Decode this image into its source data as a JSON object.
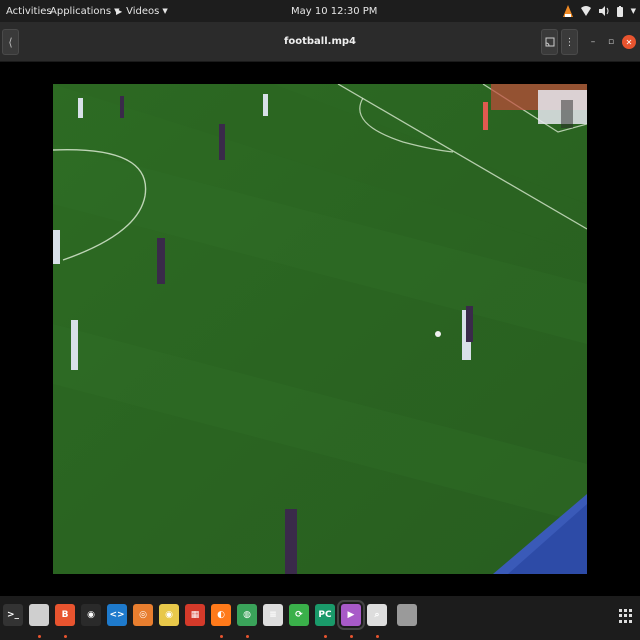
{
  "topbar": {
    "activities": "Activities",
    "applications": "Applications",
    "app_menu": "Videos",
    "clock": "May 10  12:30 PM"
  },
  "window": {
    "title": "football.mp4"
  },
  "dock": {
    "apps": [
      {
        "name": "terminal-icon",
        "glyph": ">_",
        "color": "#333333",
        "running": false
      },
      {
        "name": "files-icon",
        "glyph": "",
        "color": "#cfcfcf",
        "running": true
      },
      {
        "name": "brave-icon",
        "glyph": "B",
        "color": "#e8542f",
        "running": true
      },
      {
        "name": "obs-icon",
        "glyph": "◉",
        "color": "#2a2a2a",
        "running": false
      },
      {
        "name": "vscode-icon",
        "glyph": "<>",
        "color": "#1e7acc",
        "running": false
      },
      {
        "name": "ubuntu-software-icon",
        "glyph": "◎",
        "color": "#e87e2f",
        "running": false
      },
      {
        "name": "rhythmbox-icon",
        "glyph": "◉",
        "color": "#e8c84a",
        "running": false
      },
      {
        "name": "color-picker-icon",
        "glyph": "▦",
        "color": "#d43a2a",
        "running": false
      },
      {
        "name": "firefox-icon",
        "glyph": "◐",
        "color": "#ff7a1a",
        "running": true
      },
      {
        "name": "chrome-icon",
        "glyph": "◍",
        "color": "#3aa35a",
        "running": true
      },
      {
        "name": "text-editor-icon",
        "glyph": "≡",
        "color": "#dddddd",
        "running": false
      },
      {
        "name": "sync-icon",
        "glyph": "⟳",
        "color": "#3ab04a",
        "running": false
      },
      {
        "name": "pycharm-icon",
        "glyph": "PC",
        "color": "#1a9a6a",
        "running": true
      },
      {
        "name": "videos-icon",
        "glyph": "▶",
        "color": "#a85ac8",
        "running": true
      },
      {
        "name": "image-viewer-icon",
        "glyph": "⌕",
        "color": "#dddddd",
        "running": true
      },
      {
        "name": "trash-icon",
        "glyph": "",
        "color": "#9a9a9a",
        "running": false
      }
    ]
  }
}
